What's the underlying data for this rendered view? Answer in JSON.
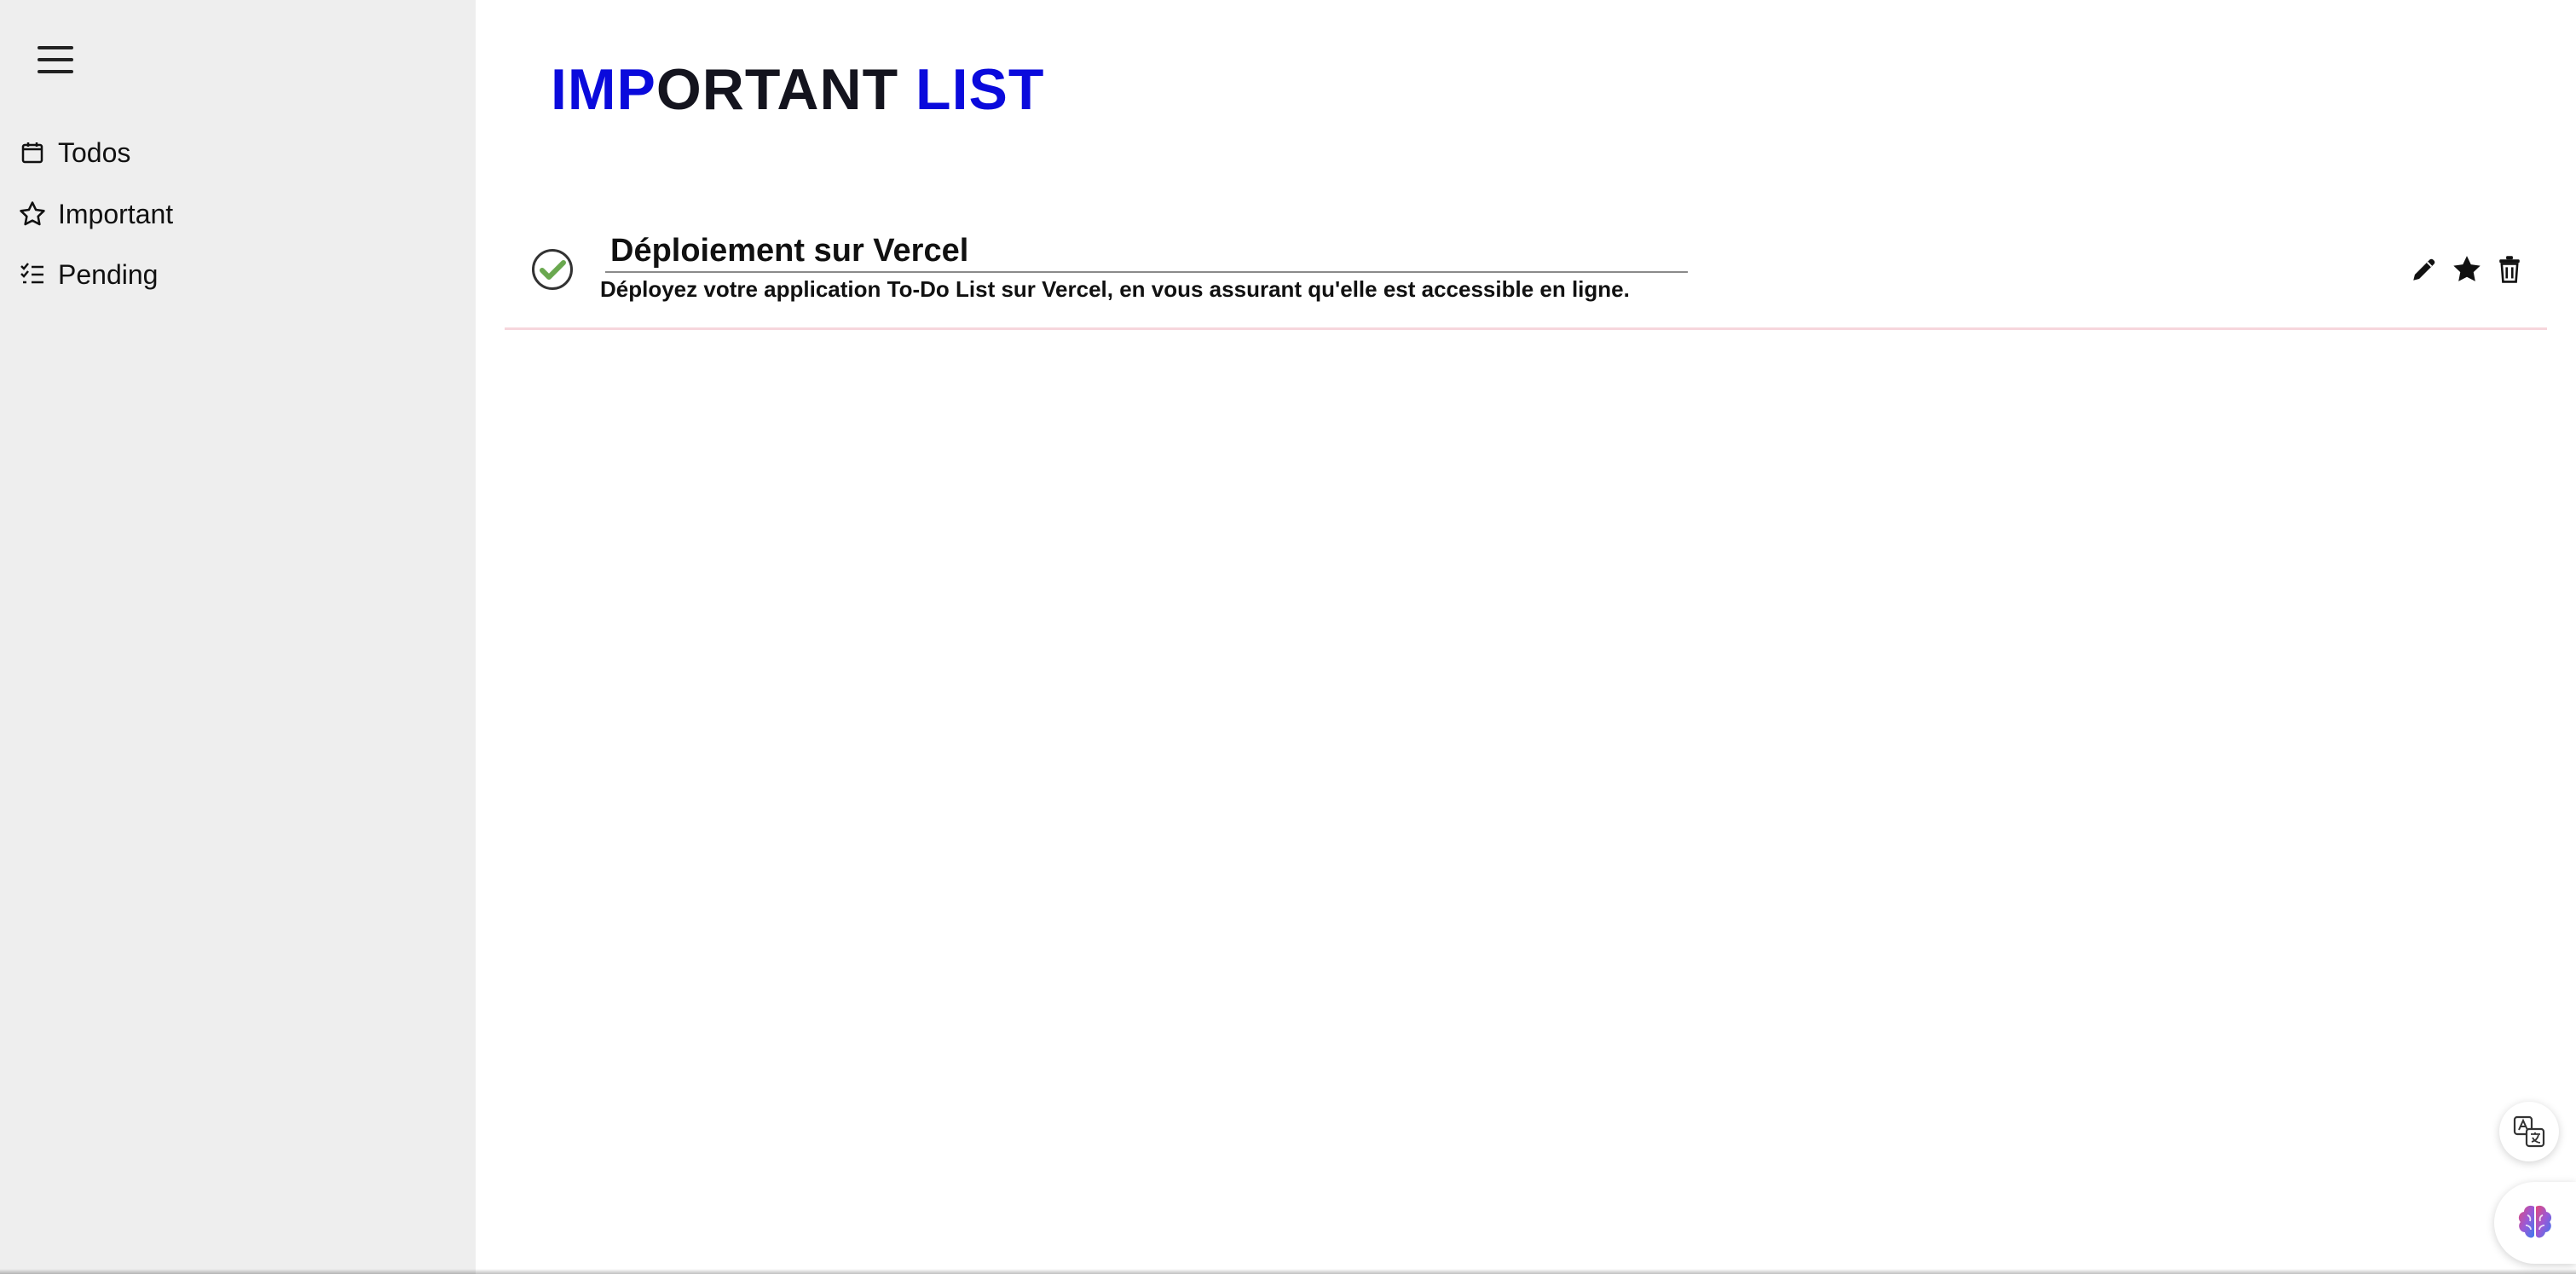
{
  "sidebar": {
    "items": [
      {
        "label": "Todos",
        "icon": "calendar-icon"
      },
      {
        "label": "Important",
        "icon": "star-outline-icon"
      },
      {
        "label": "Pending",
        "icon": "checklist-icon"
      }
    ]
  },
  "main": {
    "title_part1": "IMP",
    "title_part2": "ORTANT ",
    "title_part3": "LIST",
    "todos": [
      {
        "title": "Déploiement sur Vercel",
        "description": "Déployez votre application To-Do List sur Vercel, en vous assurant qu'elle est accessible en ligne.",
        "completed": true,
        "important": true
      }
    ]
  },
  "colors": {
    "accent_blue": "#0a0adc",
    "sidebar_bg": "#eeeeee",
    "check_green": "#6aa84f",
    "row_divider": "#f6d6dc"
  }
}
